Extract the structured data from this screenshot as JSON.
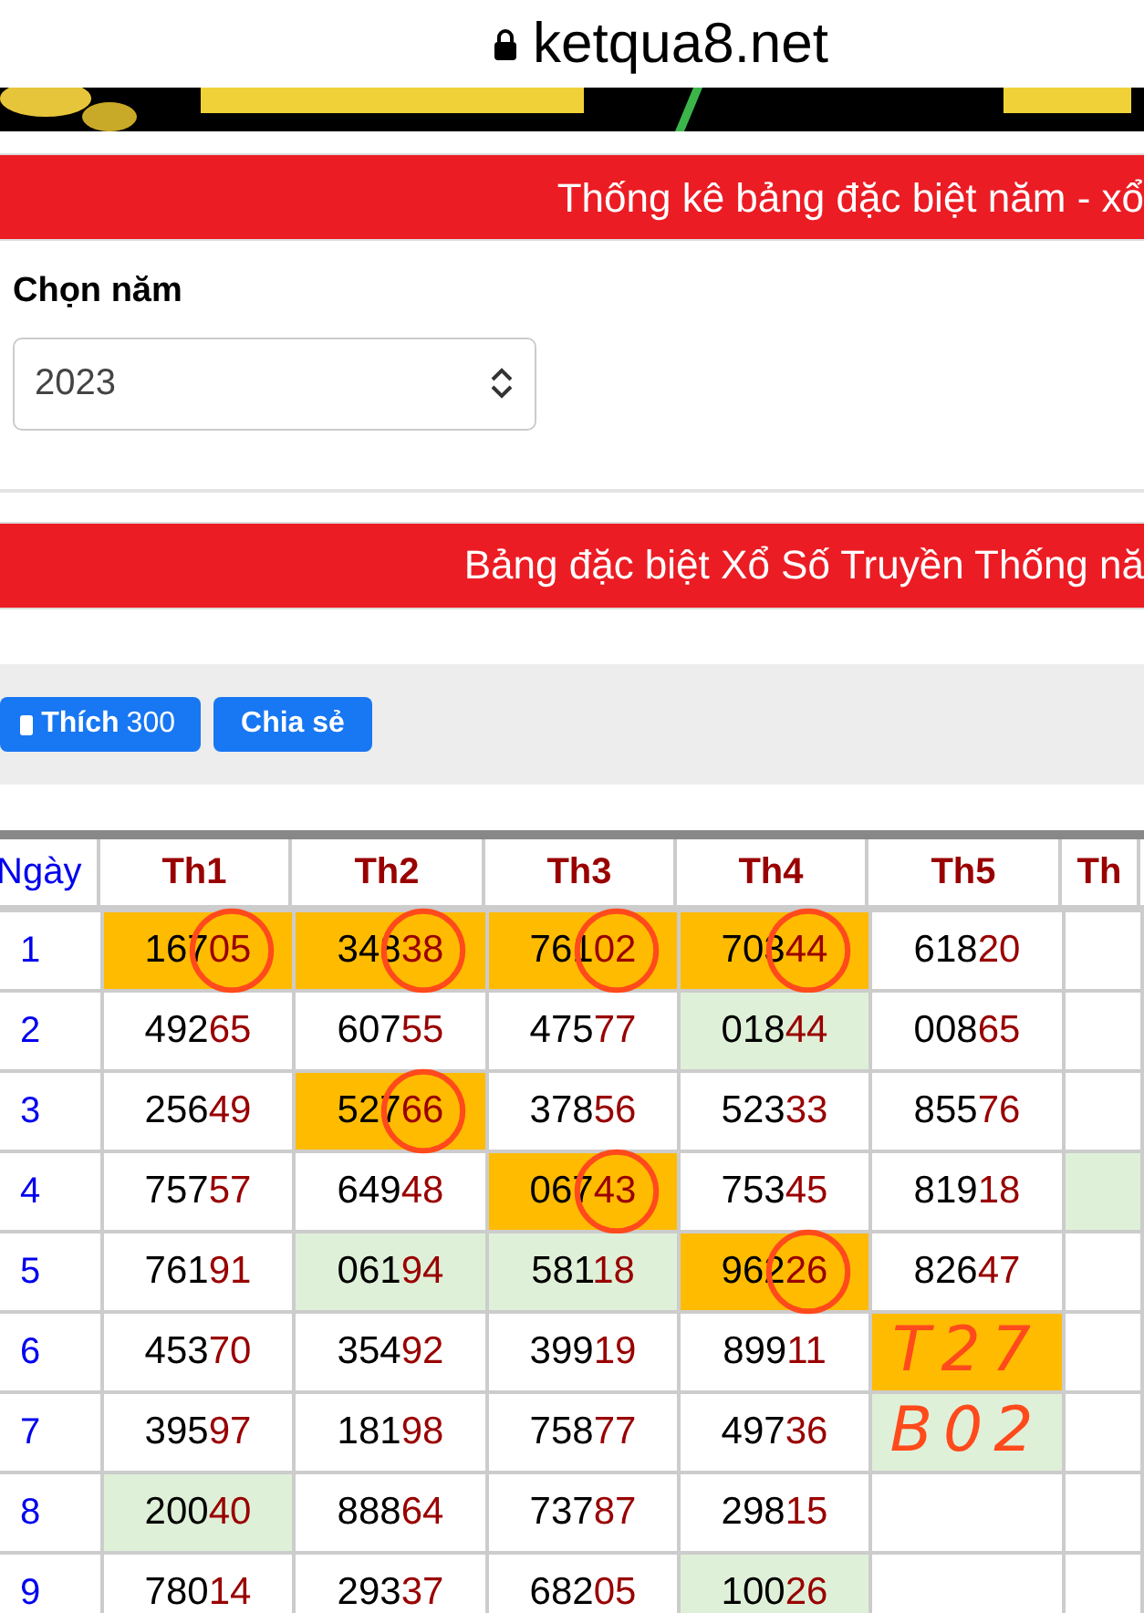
{
  "address_bar": {
    "url": "ketqua8.net"
  },
  "banner_title": "Thống kê bảng đặc biệt năm - xổ",
  "year_picker": {
    "label": "Chọn năm",
    "value": "2023"
  },
  "table_title": "Bảng đặc biệt Xổ Số Truyền Thống nă",
  "social": {
    "like_label": "Thích",
    "like_count": "300",
    "share_label": "Chia sẻ"
  },
  "table": {
    "columns": [
      "Ngày",
      "Th1",
      "Th2",
      "Th3",
      "Th4",
      "Th5",
      "Th"
    ],
    "rows": [
      {
        "cells": [
          {
            "value": "1"
          },
          {
            "value": "16705",
            "color": "#ffbb00",
            "circled": true
          },
          {
            "value": "34838",
            "color": "#ffbb00",
            "circled": true
          },
          {
            "value": "76102",
            "color": "#ffbb00",
            "circled": true
          },
          {
            "value": "70344",
            "color": "#ffbb00",
            "circled": true
          },
          {
            "value": "61820"
          },
          {}
        ]
      },
      {
        "cells": [
          {
            "value": "2"
          },
          {
            "value": "49265"
          },
          {
            "value": "60755"
          },
          {
            "value": "47577"
          },
          {
            "value": "01844",
            "color": "#dff0d8"
          },
          {
            "value": "00865"
          },
          {}
        ]
      },
      {
        "cells": [
          {
            "value": "3"
          },
          {
            "value": "25649"
          },
          {
            "value": "52766",
            "color": "#ffbb00",
            "circled": true
          },
          {
            "value": "37856"
          },
          {
            "value": "52333"
          },
          {
            "value": "85576"
          },
          {}
        ]
      },
      {
        "cells": [
          {
            "value": "4"
          },
          {
            "value": "75757"
          },
          {
            "value": "64948"
          },
          {
            "value": "06743",
            "color": "#ffbb00",
            "circled": true
          },
          {
            "value": "75345"
          },
          {
            "value": "81918"
          },
          {
            "color": "#dff0d8"
          }
        ]
      },
      {
        "cells": [
          {
            "value": "5"
          },
          {
            "value": "76191"
          },
          {
            "value": "06194",
            "color": "#dff0d8"
          },
          {
            "value": "58118",
            "color": "#dff0d8"
          },
          {
            "value": "96226",
            "color": "#ffbb00",
            "circled": true
          },
          {
            "value": "82647"
          },
          {}
        ]
      },
      {
        "cells": [
          {
            "value": "6"
          },
          {
            "value": "45370"
          },
          {
            "value": "35492"
          },
          {
            "value": "39919"
          },
          {
            "value": "89911"
          },
          {
            "note": "T27",
            "color": "#ffbb00"
          },
          {}
        ]
      },
      {
        "cells": [
          {
            "value": "7"
          },
          {
            "value": "39597"
          },
          {
            "value": "18198"
          },
          {
            "value": "75877"
          },
          {
            "value": "49736"
          },
          {
            "note": "B02",
            "color": "#dff0d8"
          },
          {}
        ]
      },
      {
        "cells": [
          {
            "value": "8"
          },
          {
            "value": "20040",
            "color": "#dff0d8"
          },
          {
            "value": "88864"
          },
          {
            "value": "73787"
          },
          {
            "value": "29815"
          },
          {},
          {}
        ]
      },
      {
        "cells": [
          {
            "value": "9"
          },
          {
            "value": "78014"
          },
          {
            "value": "29337"
          },
          {
            "value": "68205"
          },
          {
            "value": "10026",
            "color": "#dff0d8"
          },
          {},
          {}
        ]
      }
    ]
  }
}
